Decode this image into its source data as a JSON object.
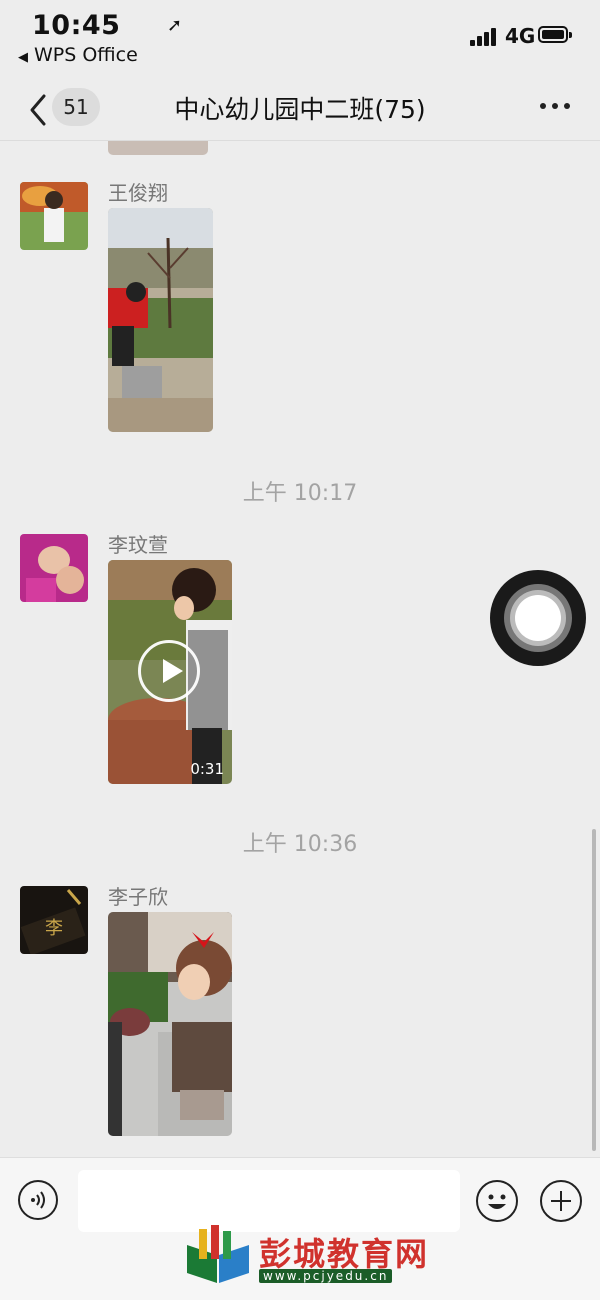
{
  "status_bar": {
    "time": "10:45",
    "location_glyph": "➚",
    "back_app": "WPS Office",
    "network": "4G"
  },
  "nav": {
    "unread_count": "51",
    "title": "中心幼儿园中二班(75)"
  },
  "messages": [
    {
      "type": "photo",
      "sender": "王俊翔"
    },
    {
      "type": "timestamp",
      "text": "上午 10:17"
    },
    {
      "type": "video",
      "sender": "李玟萱",
      "duration": "0:31"
    },
    {
      "type": "timestamp",
      "text": "上午 10:36"
    },
    {
      "type": "photo",
      "sender": "李子欣"
    }
  ],
  "watermark": {
    "text": "彭城教育网",
    "url": "www.pcjyedu.cn"
  },
  "icons": {
    "back": "chevron-left-icon",
    "more": "more-dots-icon",
    "voice": "voice-icon",
    "emoji": "emoji-icon",
    "plus": "plus-icon"
  }
}
